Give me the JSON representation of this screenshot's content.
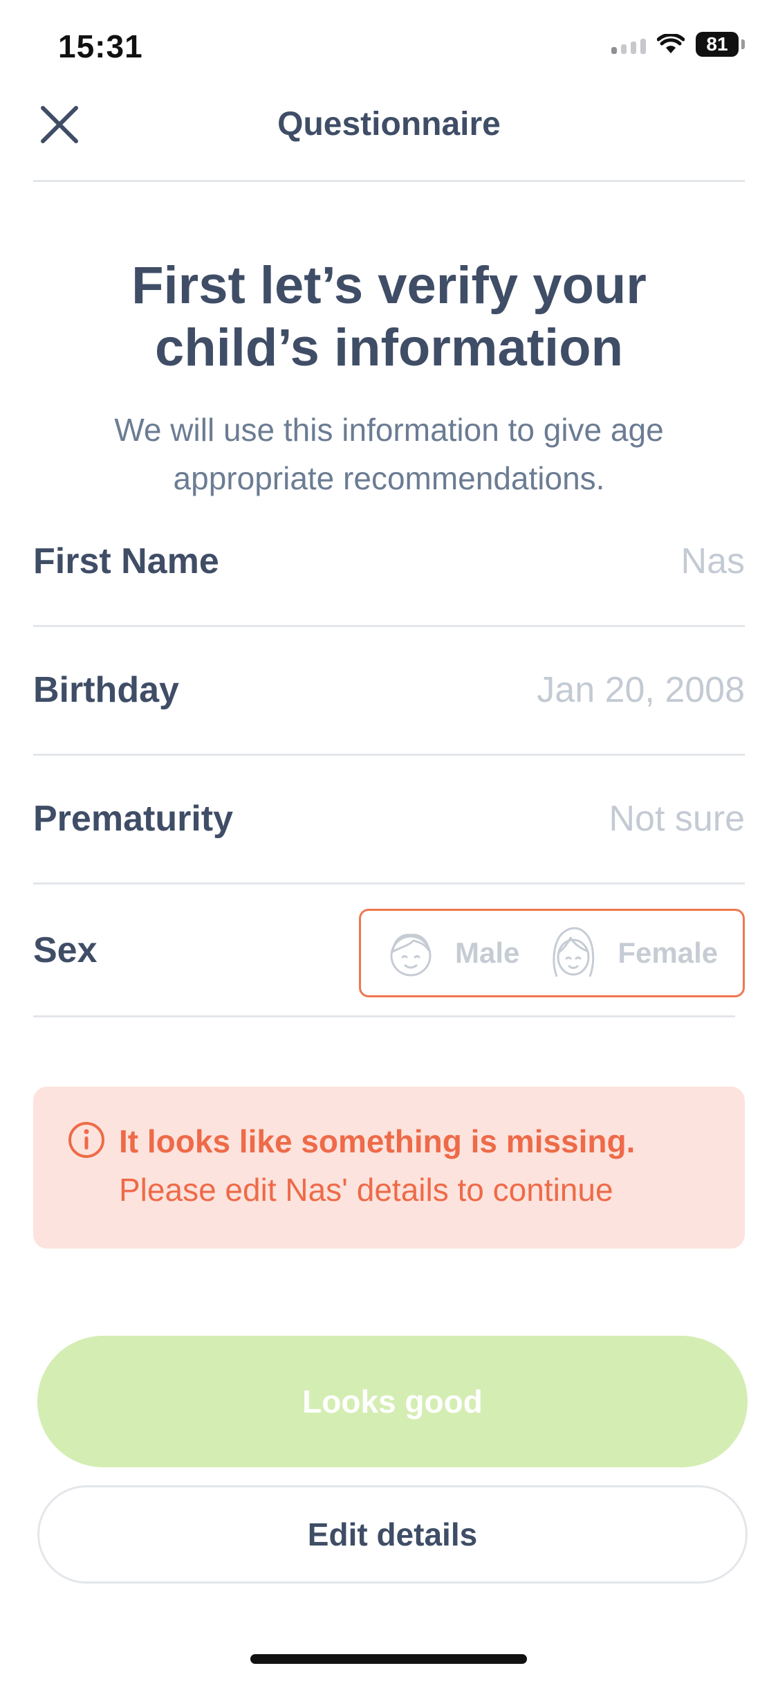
{
  "status_bar": {
    "time": "15:31",
    "battery": "81",
    "icons": [
      "signal-icon",
      "wifi-icon",
      "battery-icon"
    ]
  },
  "nav": {
    "title": "Questionnaire",
    "close_icon": "close-icon"
  },
  "header": {
    "headline_line1": "First let’s verify your",
    "headline_line2": "child’s information",
    "subtext_line1": "We will use this information to give age",
    "subtext_line2": "appropriate recommendations."
  },
  "form": {
    "first_name": {
      "label": "First Name",
      "value": "Nas"
    },
    "birthday": {
      "label": "Birthday",
      "value": "Jan 20, 2008"
    },
    "prematurity": {
      "label": "Prematurity",
      "value": "Not sure"
    },
    "sex": {
      "label": "Sex",
      "options": [
        {
          "label": "Male",
          "icon": "boy-face-icon"
        },
        {
          "label": "Female",
          "icon": "girl-face-icon"
        }
      ]
    }
  },
  "error": {
    "icon": "info-icon",
    "title": "It looks like something is missing.",
    "message": "Please edit Nas' details to continue"
  },
  "actions": {
    "primary": "Looks good",
    "secondary": "Edit details"
  },
  "colors": {
    "text_primary": "#3f4d66",
    "text_secondary": "#6b7c93",
    "placeholder": "#c3cad3",
    "error": "#ee6a48",
    "error_bg": "#fde3dd",
    "primary_disabled": "#d4edb3",
    "divider": "#e3e6ea"
  }
}
